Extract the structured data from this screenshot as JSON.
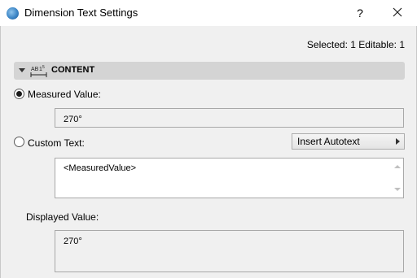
{
  "window": {
    "title": "Dimension Text Settings",
    "help_label": "?"
  },
  "selection_info": "Selected: 1 Editable: 1",
  "panel": {
    "title": "CONTENT",
    "icon": "dimension-text-icon"
  },
  "measured": {
    "label": "Measured Value:",
    "value": "270°",
    "selected": true
  },
  "custom": {
    "label": "Custom Text:",
    "insert_autotext_label": "Insert Autotext",
    "text_value": "<MeasuredValue>"
  },
  "displayed": {
    "label": "Displayed Value:",
    "value": "270°"
  }
}
